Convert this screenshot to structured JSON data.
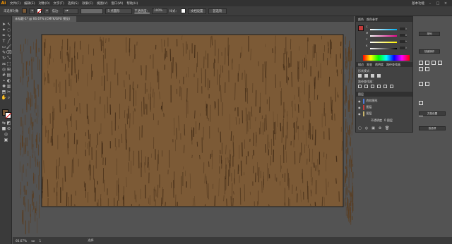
{
  "app": {
    "logo": "Ai"
  },
  "menubar": {
    "items": [
      "文件(F)",
      "编辑(E)",
      "对象(O)",
      "文字(T)",
      "选择(S)",
      "效果(C)",
      "视图(V)",
      "窗口(W)",
      "帮助(H)"
    ],
    "workspace": "基本功能"
  },
  "ctrlbar": {
    "selection_label": "未选择对象",
    "stroke_label": "描边：",
    "brush_label": "5 点圆形",
    "opacity_label": "不透明度：",
    "opacity_value": "100%",
    "style_label": "样式：",
    "doc_setup": "文档设置",
    "preferences": "首选项"
  },
  "doc": {
    "tab_label": "未标题-1* @ 66.67% (CMYK/GPU 预览)"
  },
  "status": {
    "zoom": "66.67%",
    "page": "1",
    "tool": "选择"
  },
  "panels": {
    "color_tabs": [
      "颜色",
      "颜色参考"
    ],
    "sliders": [
      {
        "label": "C",
        "value": "0"
      },
      {
        "label": "M",
        "value": "0"
      },
      {
        "label": "Y",
        "value": "0"
      },
      {
        "label": "K",
        "value": "0"
      }
    ],
    "brush_tabs": [
      "描边",
      "渐变",
      "透明度",
      "路径查找器"
    ],
    "shape_modes": "形状模式：",
    "pathfinders": "路径查找器：",
    "layers_tab": "图层",
    "layers": [
      {
        "name": "底纹图形",
        "color": "#4f7ddb"
      },
      {
        "name": "图层",
        "color": "#c33b3b"
      },
      {
        "name": "图层",
        "color": "#c7b36a"
      }
    ],
    "layer_controls": [
      "不透明度",
      "0 图层"
    ]
  },
  "props": {
    "quick_actions_1": "排列",
    "quick_actions_2": "快速操作",
    "doc_setup": "文档设置",
    "preferences": "首选项"
  },
  "colors": {
    "accent": "#ff9a00",
    "wood_base": "#7c5a36",
    "wood_grain": "#3a2512"
  }
}
